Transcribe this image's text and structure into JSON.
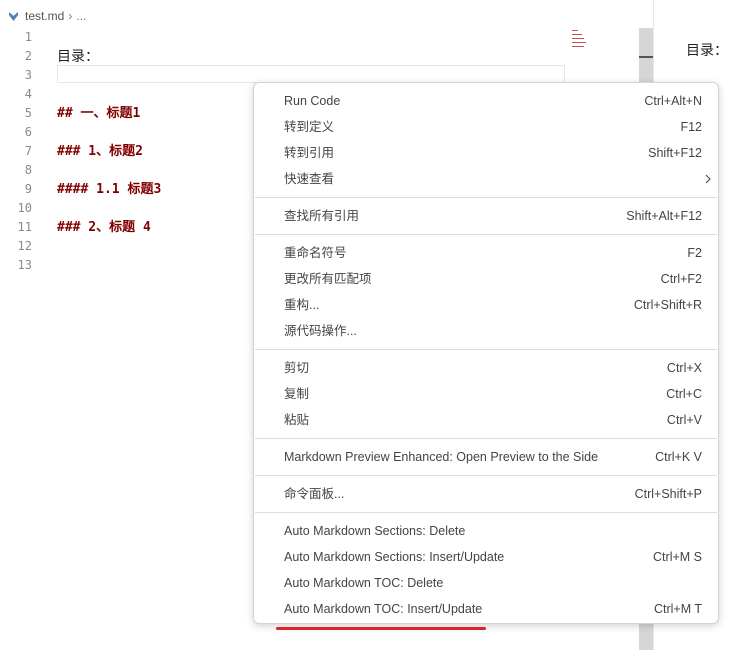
{
  "breadcrumb": {
    "file": "test.md",
    "separator": "›",
    "more": "..."
  },
  "editor": {
    "lines": [
      {
        "number": "1",
        "text": "",
        "style": "plain"
      },
      {
        "number": "2",
        "text": "目录：",
        "style": "plain"
      },
      {
        "number": "3",
        "text": "",
        "style": "plain"
      },
      {
        "number": "4",
        "text": "",
        "style": "plain"
      },
      {
        "number": "5",
        "text": "## 一、标题1",
        "style": "heading"
      },
      {
        "number": "6",
        "text": "",
        "style": "plain"
      },
      {
        "number": "7",
        "text": "### 1、标题2",
        "style": "heading"
      },
      {
        "number": "8",
        "text": "",
        "style": "plain"
      },
      {
        "number": "9",
        "text": "#### 1.1 标题3",
        "style": "heading"
      },
      {
        "number": "10",
        "text": "",
        "style": "plain"
      },
      {
        "number": "11",
        "text": "### 2、标题 4",
        "style": "heading"
      },
      {
        "number": "12",
        "text": "",
        "style": "plain"
      },
      {
        "number": "13",
        "text": "",
        "style": "plain"
      }
    ]
  },
  "preview": {
    "title": "目录："
  },
  "context_menu": {
    "groups": [
      [
        {
          "label": "Run Code",
          "shortcut": "Ctrl+Alt+N"
        },
        {
          "label": "转到定义",
          "shortcut": "F12"
        },
        {
          "label": "转到引用",
          "shortcut": "Shift+F12"
        },
        {
          "label": "快速查看",
          "shortcut": "",
          "submenu": true
        }
      ],
      [
        {
          "label": "查找所有引用",
          "shortcut": "Shift+Alt+F12"
        }
      ],
      [
        {
          "label": "重命名符号",
          "shortcut": "F2"
        },
        {
          "label": "更改所有匹配项",
          "shortcut": "Ctrl+F2"
        },
        {
          "label": "重构...",
          "shortcut": "Ctrl+Shift+R"
        },
        {
          "label": "源代码操作...",
          "shortcut": ""
        }
      ],
      [
        {
          "label": "剪切",
          "shortcut": "Ctrl+X"
        },
        {
          "label": "复制",
          "shortcut": "Ctrl+C"
        },
        {
          "label": "粘贴",
          "shortcut": "Ctrl+V"
        }
      ],
      [
        {
          "label": "Markdown Preview Enhanced: Open Preview to the Side",
          "shortcut": "Ctrl+K V"
        }
      ],
      [
        {
          "label": "命令面板...",
          "shortcut": "Ctrl+Shift+P"
        }
      ],
      [
        {
          "label": "Auto Markdown Sections: Delete",
          "shortcut": ""
        },
        {
          "label": "Auto Markdown Sections: Insert/Update",
          "shortcut": "Ctrl+M S"
        },
        {
          "label": "Auto Markdown TOC: Delete",
          "shortcut": ""
        },
        {
          "label": "Auto Markdown TOC: Insert/Update",
          "shortcut": "Ctrl+M T"
        }
      ]
    ]
  },
  "colors": {
    "heading_text": "#800000",
    "highlight_underline": "#d9262f",
    "markdown_icon": "#4a7fb0"
  },
  "icons": {
    "markdown": "markdown-file-icon",
    "submenu": "chevron-right-icon"
  }
}
